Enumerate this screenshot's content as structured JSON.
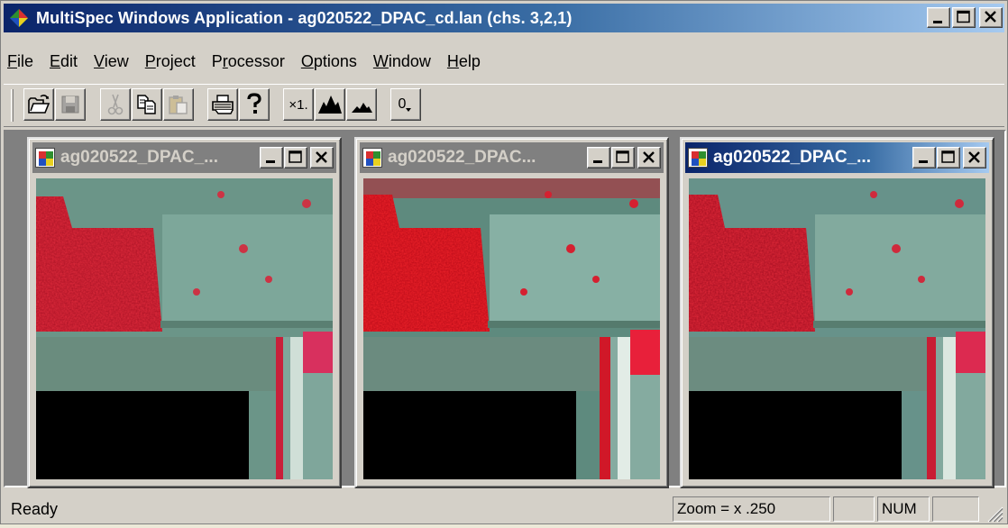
{
  "window": {
    "title": "MultiSpec Windows Application - ag020522_DPAC_cd.lan (chs. 3,2,1)"
  },
  "menu": [
    {
      "pre": "",
      "u": "F",
      "post": "ile"
    },
    {
      "pre": "",
      "u": "E",
      "post": "dit"
    },
    {
      "pre": "",
      "u": "V",
      "post": "iew"
    },
    {
      "pre": "",
      "u": "P",
      "post": "roject"
    },
    {
      "pre": "P",
      "u": "r",
      "post": "ocessor"
    },
    {
      "pre": "",
      "u": "O",
      "post": "ptions"
    },
    {
      "pre": "",
      "u": "W",
      "post": "indow"
    },
    {
      "pre": "",
      "u": "H",
      "post": "elp"
    }
  ],
  "toolbar": {
    "zoom_x1_label": "×1.",
    "overlay_label": "0"
  },
  "children": [
    {
      "title": "ag020522_DPAC_..."
    },
    {
      "title": "ag020522_DPAC..."
    },
    {
      "title": "ag020522_DPAC_..."
    }
  ],
  "status": {
    "message": "Ready",
    "zoom": "Zoom = x .250",
    "num": "NUM"
  },
  "colors": {
    "active_caption": "#0a246a",
    "inactive_caption": "#808080",
    "face": "#d4d0c8",
    "vegetation_red": "#d8202e",
    "field_teal": "#5f8b80"
  }
}
